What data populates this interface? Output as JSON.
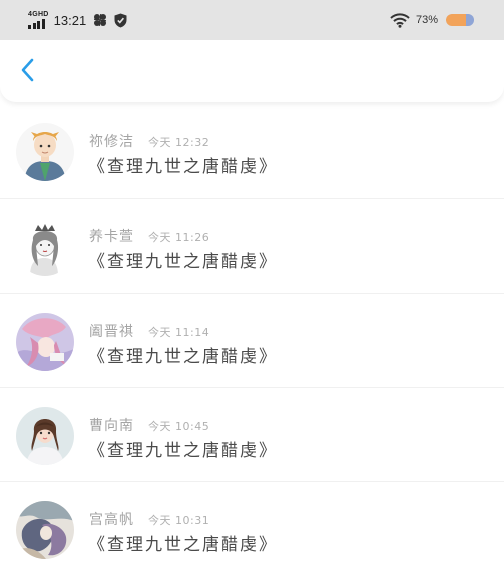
{
  "status_bar": {
    "network": "4GHD",
    "time": "13:21",
    "battery": "73%",
    "battery_level": 0.73,
    "icons": [
      "signal-icon",
      "pinwheel-icon",
      "shield-icon",
      "wifi-icon",
      "battery-icon"
    ]
  },
  "nav": {
    "back_icon": "chevron-left-icon",
    "accent": "#2a9de8"
  },
  "items": [
    {
      "name": "祢修洁",
      "time": "今天 12:32",
      "title": "《查理九世之唐醋虔》",
      "avatar": "cartoon-boy-avatar"
    },
    {
      "name": "养卡萱",
      "time": "今天 11:26",
      "title": "《查理九世之唐醋虔》",
      "avatar": "sketch-girl-avatar"
    },
    {
      "name": "阖晋祺",
      "time": "今天 11:14",
      "title": "《查理九世之唐醋虔》",
      "avatar": "anime-girl-avatar"
    },
    {
      "name": "曹向南",
      "time": "今天 10:45",
      "title": "《查理九世之唐醋虔》",
      "avatar": "photo-girl-avatar"
    },
    {
      "name": "宫高帆",
      "time": "今天 10:31",
      "title": "《查理九世之唐醋虔》",
      "avatar": "illustration-avatar"
    }
  ]
}
